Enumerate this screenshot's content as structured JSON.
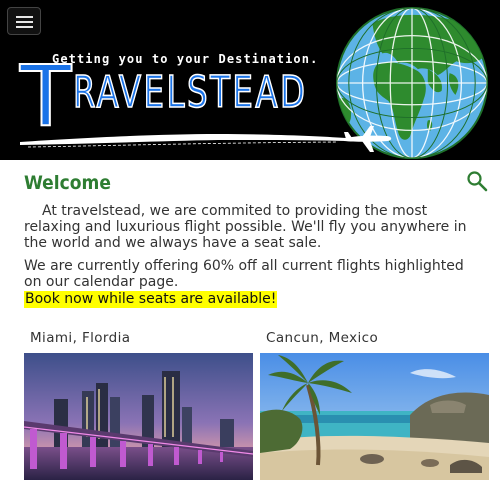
{
  "header": {
    "menu_icon": "hamburger-icon",
    "tagline": "Getting you to your Destination.",
    "logo_first_letter": "T",
    "logo_rest": "RAVELSTEAD",
    "colors": {
      "background": "#000000",
      "logo": "#1a73e8",
      "globe_ocean": "#5cb3e6",
      "globe_land": "#2e8b2e"
    }
  },
  "main": {
    "title": "Welcome",
    "search_icon": "search-icon",
    "paragraphs": [
      "At travelstead, we are commited to providing the most relaxing and luxurious flight possible. We'll fly you anywhere in the world and we always have a seat sale.",
      "We are currently offering 60% off all current flights highlighted on our calendar page."
    ],
    "highlight": "Book now while seats are available!",
    "destinations": [
      {
        "name": "Miami, Flordia"
      },
      {
        "name": "Cancun, Mexico"
      }
    ],
    "colors": {
      "title": "#2e7d32",
      "highlight": "#ffff00"
    }
  }
}
